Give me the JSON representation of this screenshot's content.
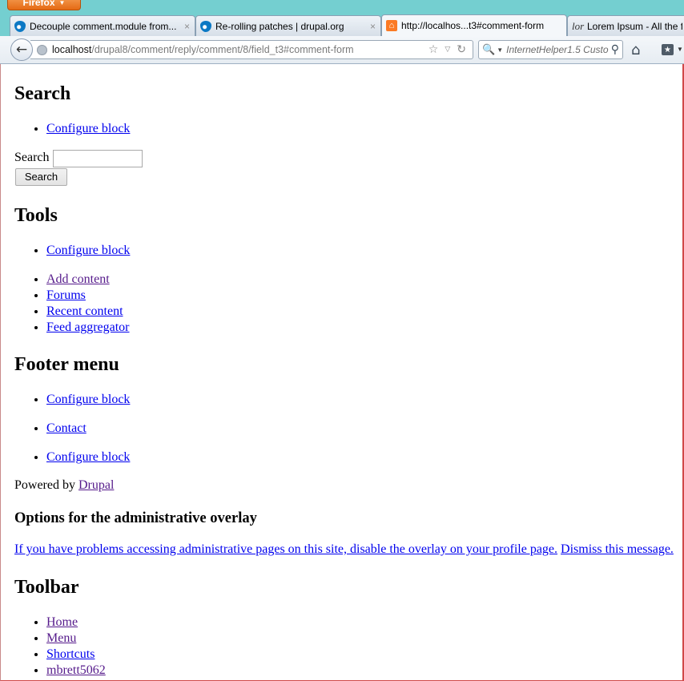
{
  "browser": {
    "menu_label": "Firefox",
    "tabs": [
      {
        "title": "Decouple comment.module from...",
        "icon": "drupal-icon",
        "active": false
      },
      {
        "title": "Re-rolling patches | drupal.org",
        "icon": "drupal-icon",
        "active": false
      },
      {
        "title": "http://localhos...t3#comment-form",
        "icon": "xampp-icon",
        "active": true
      },
      {
        "title": "Lorem Ipsum - All the f",
        "icon": "lorem-icon",
        "active": false
      }
    ],
    "close_glyph": "×",
    "url_host": "localhost",
    "url_path": "/drupal8/comment/reply/comment/8/field_t3#comment-form",
    "search_placeholder": "InternetHelper1.5 Custo",
    "icons": {
      "back": "back-arrow-icon",
      "star": "bookmark-star-icon",
      "reload": "reload-icon",
      "search_engine": "search-engine-icon",
      "go": "magnifier-icon",
      "home": "home-icon",
      "bookmarks": "bookmarks-icon"
    }
  },
  "page": {
    "search_block": {
      "heading": "Search",
      "configure_link": "Configure block",
      "field_label": "Search",
      "submit_label": "Search"
    },
    "tools_block": {
      "heading": "Tools",
      "configure_link": "Configure block",
      "links": [
        "Add content",
        "Forums",
        "Recent content",
        "Feed aggregator"
      ]
    },
    "footer_block": {
      "heading": "Footer menu",
      "configure_link_1": "Configure block",
      "contact_link": "Contact",
      "configure_link_2": "Configure block"
    },
    "powered_by": {
      "prefix": "Powered by ",
      "link": "Drupal"
    },
    "overlay_block": {
      "heading": "Options for the administrative overlay",
      "disable_link": "If you have problems accessing administrative pages on this site, disable the overlay on your profile page.",
      "dismiss_link": "Dismiss this message."
    },
    "toolbar_block": {
      "heading": "Toolbar",
      "links": [
        "Home",
        "Menu",
        "Shortcuts",
        "mbrett5062"
      ]
    }
  },
  "colors": {
    "link": "#0000ee",
    "visited_link": "#551a8b",
    "window_frame": "#74cfd0",
    "firefox_button": "#e56a14"
  }
}
